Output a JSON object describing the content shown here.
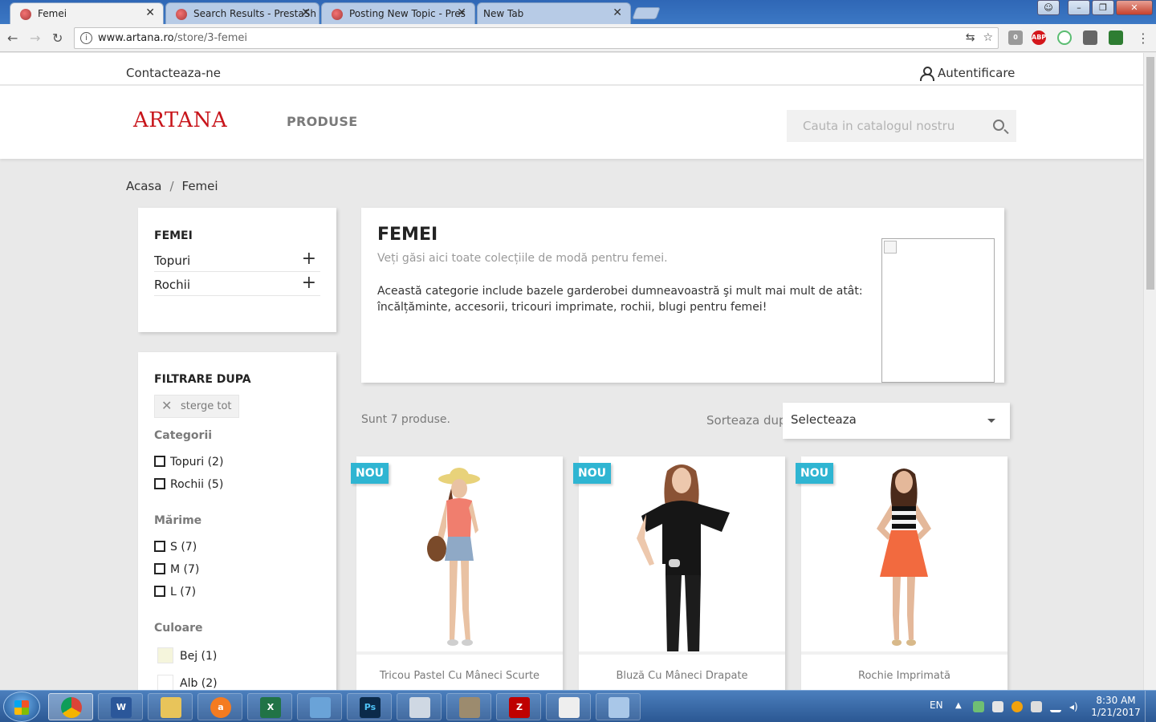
{
  "browser": {
    "tabs": [
      {
        "title": "Femei",
        "active": true
      },
      {
        "title": "Search Results - PrestaSh",
        "active": false
      },
      {
        "title": "Posting New Topic - Pres",
        "active": false
      },
      {
        "title": "New Tab",
        "active": false
      }
    ],
    "url_domain": "www.artana.ro",
    "url_path": "/store/3-femei",
    "extension_badge": "0",
    "abp_label": "ABP"
  },
  "topbar": {
    "contact": "Contacteaza-ne",
    "login": "Autentificare"
  },
  "header": {
    "logo": "ARTANA",
    "menu_item": "PRODUSE",
    "search_placeholder": "Cauta in catalogul nostru"
  },
  "breadcrumb": {
    "home": "Acasa",
    "separator": "/",
    "current": "Femei"
  },
  "category_tree": {
    "title": "FEMEI",
    "items": [
      {
        "label": "Topuri"
      },
      {
        "label": "Rochii"
      }
    ]
  },
  "filters": {
    "title": "FILTRARE DUPA",
    "clear_all": "sterge tot",
    "categories_title": "Categorii",
    "categories": [
      {
        "label": "Topuri (2)"
      },
      {
        "label": "Rochii (5)"
      }
    ],
    "size_title": "Mărime",
    "sizes": [
      {
        "label": "S (7)"
      },
      {
        "label": "M (7)"
      },
      {
        "label": "L (7)"
      }
    ],
    "color_title": "Culoare",
    "colors": [
      {
        "label": "Bej (1)",
        "swatch": "#f5f5dc"
      },
      {
        "label": "Alb (2)",
        "swatch": "#ffffff"
      }
    ]
  },
  "category_description": {
    "title": "FEMEI",
    "subtitle": "Veți găsi aici toate colecțiile de modă pentru femei.",
    "body": "Această categorie include bazele garderobei dumneavoastră şi mult mai mult de atât: încălțăminte, accesorii, tricouri imprimate, rochii, blugi pentru femei!"
  },
  "listing": {
    "count_text": "Sunt 7 produse.",
    "sort_label": "Sorteaza dupa:",
    "sort_value": "Selecteaza"
  },
  "products": [
    {
      "badge": "NOU",
      "name": "Tricou Pastel Cu Mâneci Scurte"
    },
    {
      "badge": "NOU",
      "name": "Bluză Cu Mâneci Drapate"
    },
    {
      "badge": "NOU",
      "name": "Rochie Imprimată"
    }
  ],
  "taskbar": {
    "lang": "EN",
    "time": "8:30 AM",
    "date": "1/21/2017"
  },
  "colors": {
    "brand_red": "#c8151b",
    "badge_blue": "#2fb5d2"
  }
}
